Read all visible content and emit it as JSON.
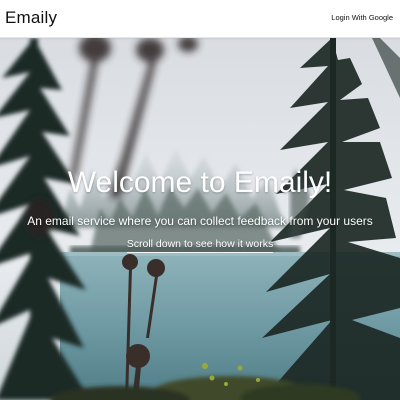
{
  "navbar": {
    "brand": "Emaily",
    "login_label": "Login With Google"
  },
  "hero": {
    "title": "Welcome to Emaily!",
    "subtitle": "An email service where you can collect feedback from your users",
    "scroll_label": "Scroll down to see how it works"
  },
  "colors": {
    "sky": "#e4e8ec",
    "lake": "#6f9aa4",
    "pine": "#1d2b27"
  }
}
